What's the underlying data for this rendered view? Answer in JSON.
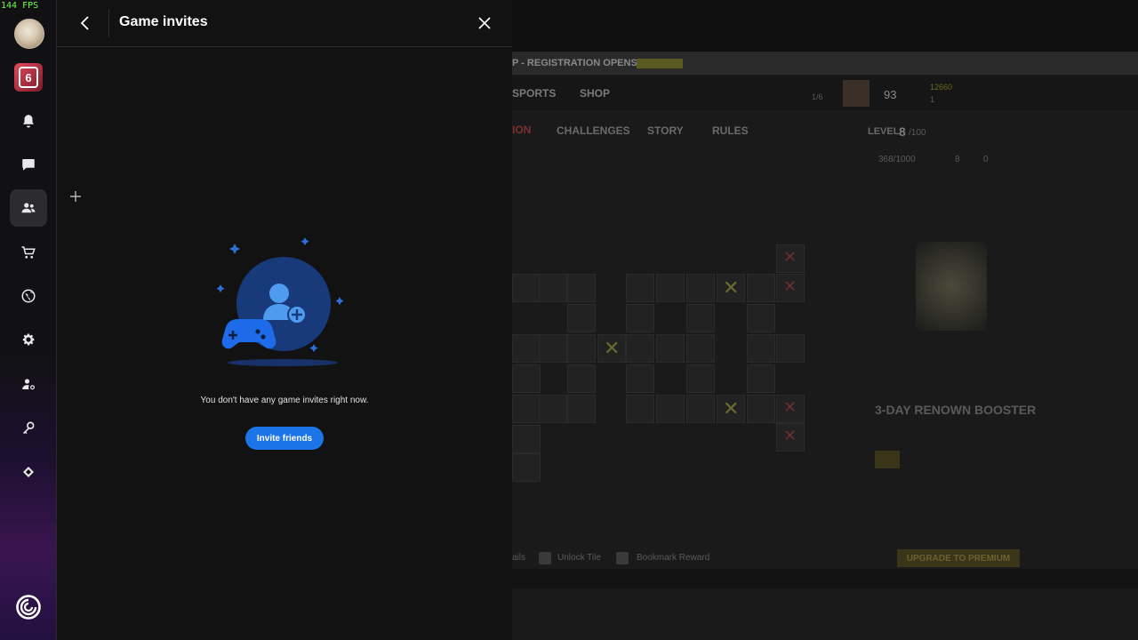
{
  "overlay": {
    "fps": "144 FPS"
  },
  "sidebar": {
    "game_icon_label": "6",
    "items": [
      {
        "name": "notifications",
        "icon": "bell-icon"
      },
      {
        "name": "chat",
        "icon": "chat-icon"
      },
      {
        "name": "friends",
        "icon": "friends-icon",
        "active": true
      },
      {
        "name": "store",
        "icon": "cart-icon"
      },
      {
        "name": "news",
        "icon": "globe-icon"
      },
      {
        "name": "settings",
        "icon": "gear-icon"
      },
      {
        "name": "account",
        "icon": "account-icon"
      },
      {
        "name": "keys",
        "icon": "key-icon"
      },
      {
        "name": "rewards",
        "icon": "rewards-icon"
      }
    ]
  },
  "panel": {
    "title": "Game invites",
    "empty_message": "You don't have any game invites right now.",
    "invite_button": "Invite friends"
  },
  "background_game": {
    "banner": "P - REGISTRATION OPENS IN",
    "nav": [
      "SPORTS",
      "SHOP"
    ],
    "squad": "1/6",
    "level_badge": "93",
    "currency": "12660",
    "currency2": "1",
    "tabs": [
      "ION",
      "CHALLENGES",
      "STORY",
      "RULES"
    ],
    "level_label": "LEVEL",
    "level_value": "8",
    "level_max": "/100",
    "xp": "368/1000",
    "stars": "8",
    "tickets": "0",
    "reward_title": "3-DAY RENOWN BOOSTER",
    "footer_unlock": "Unlock Tile",
    "footer_bookmark": "Bookmark Reward",
    "footer_left": "ails",
    "premium_button": "UPGRADE TO PREMIUM"
  },
  "colors": {
    "accent": "#1b74e8",
    "panel_bg": "#121213",
    "sidebar_bg": "#111114"
  }
}
